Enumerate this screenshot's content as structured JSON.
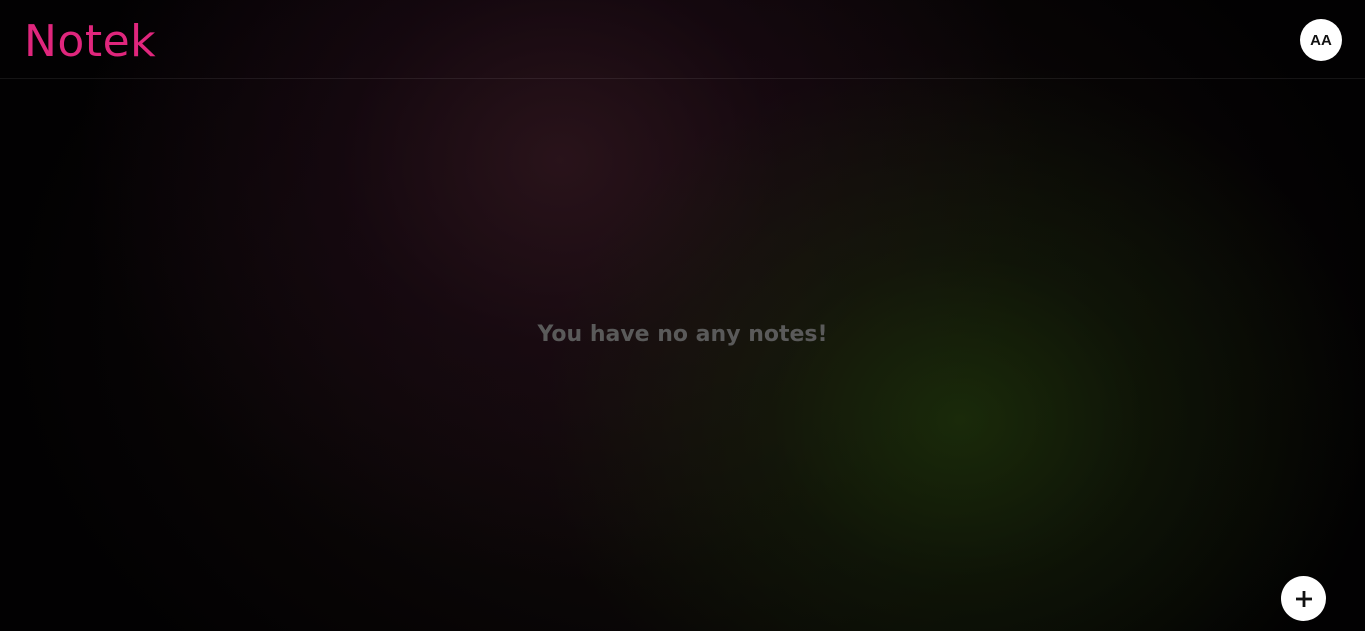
{
  "header": {
    "logo_text": "Notek",
    "avatar_initials": "AA"
  },
  "main": {
    "empty_message": "You have no any notes!"
  },
  "fab": {
    "icon": "plus-icon"
  },
  "colors": {
    "brand": "#e0267d",
    "empty_text": "#5a5a5a"
  }
}
